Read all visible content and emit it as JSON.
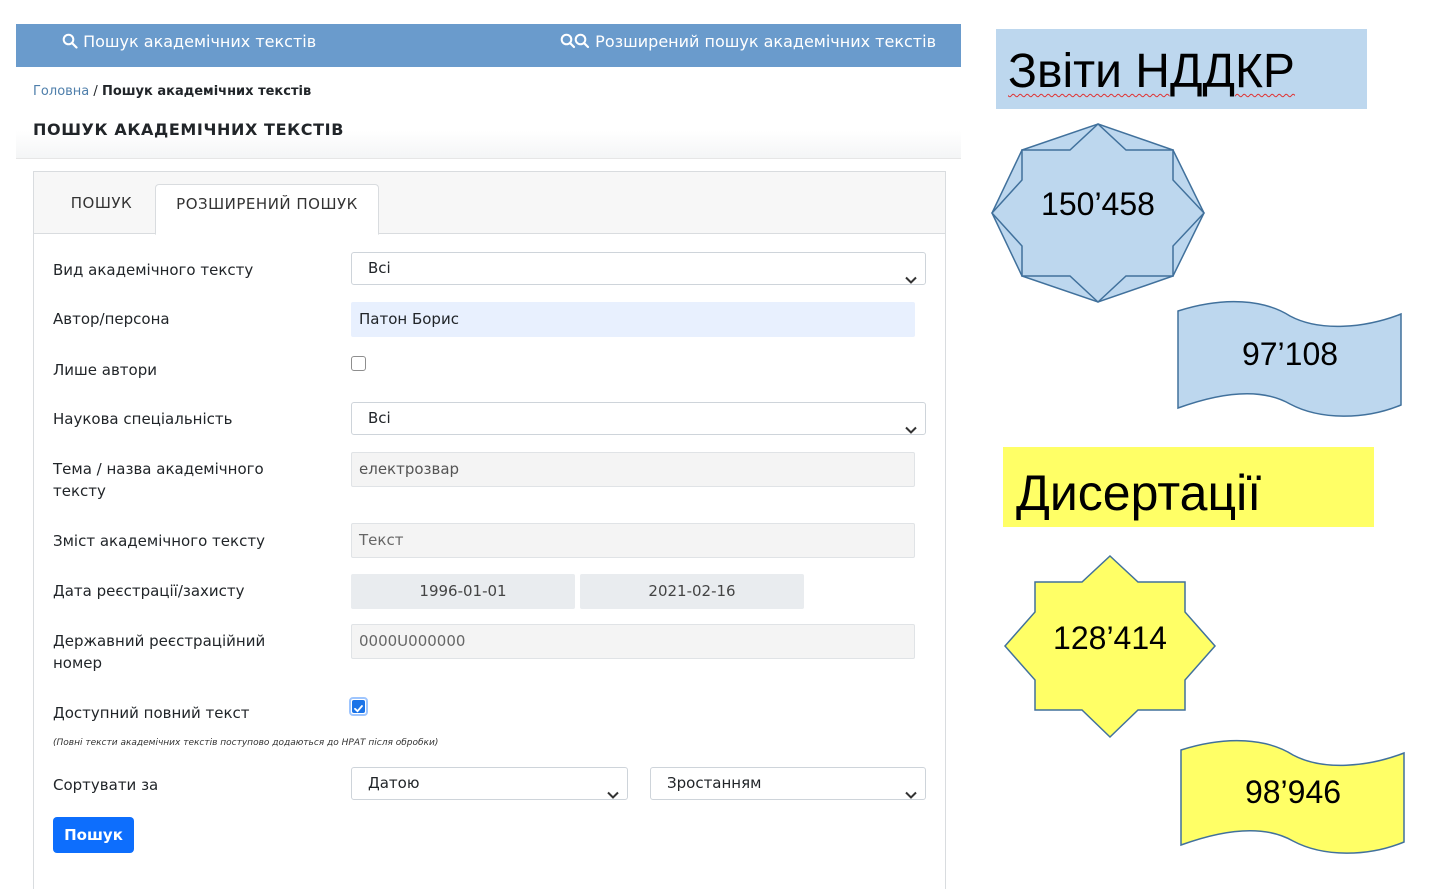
{
  "nav": {
    "basic_search": "Пошук академічних текстів",
    "advanced_search": "Розширений пошук академічних текстів"
  },
  "breadcrumb": {
    "home": "Головна",
    "separator": " / ",
    "current": "Пошук академічних текстів"
  },
  "page_title": "ПОШУК АКАДЕМІЧНИХ ТЕКСТІВ",
  "tabs": [
    {
      "label": "ПОШУК",
      "active": false
    },
    {
      "label": "РОЗШИРЕНИЙ ПОШУК",
      "active": true
    }
  ],
  "form": {
    "text_type": {
      "label": "Вид академічного тексту",
      "value": "Всі"
    },
    "author": {
      "label": "Автор/персона",
      "value": "Патон Борис"
    },
    "authors_only": {
      "label": "Лише автори",
      "checked": false
    },
    "specialty": {
      "label": "Наукова спеціальність",
      "value": "Всі"
    },
    "topic": {
      "label": "Тема / назва академічного тексту",
      "value": "електрозвар"
    },
    "content": {
      "label": "Зміст академічного тексту",
      "placeholder": "Текст"
    },
    "date": {
      "label": "Дата реєстрації/захисту",
      "from": "1996-01-01",
      "to": "2021-02-16"
    },
    "reg_number": {
      "label": "Державний реєстраційний номер",
      "placeholder": "0000U000000"
    },
    "full_text": {
      "label": "Доступний повний текст",
      "checked": true
    },
    "note": "(Повні тексти академічних текстів поступово додаються до НРАТ після обробки)",
    "sort": {
      "label": "Сортувати за",
      "field": "Датою",
      "order": "Зростанням"
    },
    "submit": "Пошук"
  },
  "infographic": {
    "reports": {
      "title": "Звіти НДДКР",
      "star_value": "150’458",
      "wave_value": "97’108",
      "color": "#bdd7ee"
    },
    "dissertations": {
      "title": "Дисертації",
      "star_value": "128’414",
      "wave_value": "98’946",
      "color": "#ffff66"
    },
    "outline_color": "#41719c"
  }
}
